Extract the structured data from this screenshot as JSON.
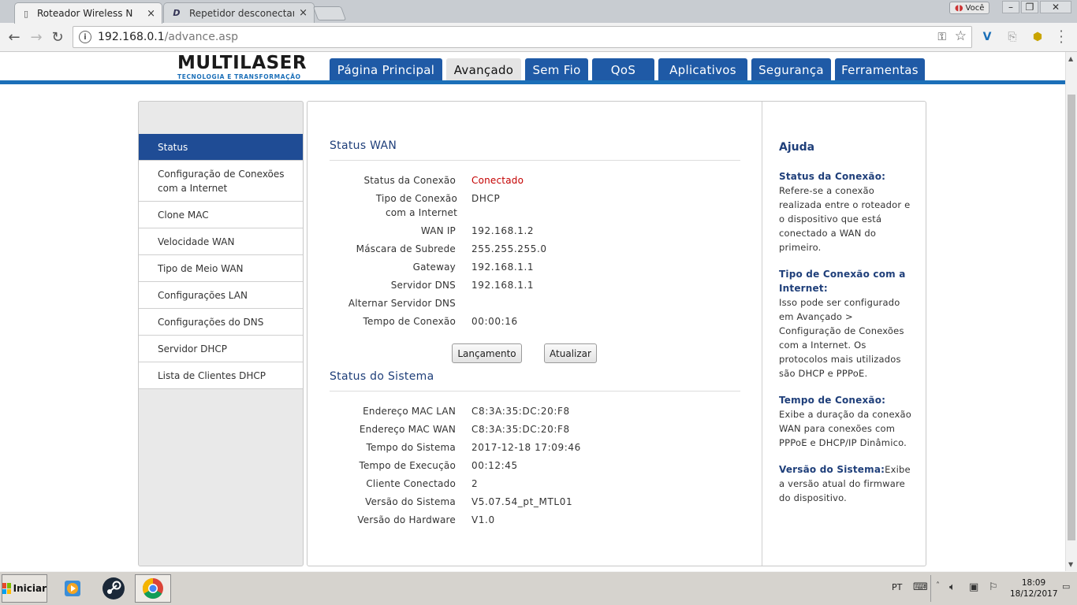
{
  "browser": {
    "tabs": [
      {
        "title": "Roteador Wireless N",
        "close": "×"
      },
      {
        "title": "Repetidor desconectando a",
        "close": "×"
      }
    ],
    "profile": "Você",
    "url_host": "192.168.0.1",
    "url_path": "/advance.asp"
  },
  "header": {
    "logo_main": "MULTILASER",
    "logo_sub": "TECNOLOGIA E TRANSFORMAÇÃO",
    "nav": [
      "Página Principal",
      "Avançado",
      "Sem Fio",
      "QoS",
      "Aplicativos",
      "Segurança",
      "Ferramentas"
    ],
    "active_nav": "Avançado"
  },
  "sidebar": {
    "items": [
      "Status",
      "Configuração de Conexões com a Internet",
      "Clone MAC",
      "Velocidade WAN",
      "Tipo de Meio WAN",
      "Configurações LAN",
      "Configurações do DNS",
      "Servidor DHCP",
      "Lista de Clientes DHCP"
    ],
    "active": "Status"
  },
  "wan": {
    "title": "Status WAN",
    "rows": [
      {
        "label": "Status da Conexão",
        "value": "Conectado"
      },
      {
        "label": "Tipo de Conexão com a Internet",
        "value": "DHCP"
      },
      {
        "label": "WAN IP",
        "value": "192.168.1.2"
      },
      {
        "label": "Máscara de Subrede",
        "value": "255.255.255.0"
      },
      {
        "label": "Gateway",
        "value": "192.168.1.1"
      },
      {
        "label": "Servidor DNS",
        "value": "192.168.1.1"
      },
      {
        "label": "Alternar Servidor DNS",
        "value": ""
      },
      {
        "label": "Tempo de Conexão",
        "value": "00:00:16"
      }
    ],
    "buttons": {
      "release": "Lançamento",
      "refresh": "Atualizar"
    },
    "status_color": "#c40000"
  },
  "system": {
    "title": "Status do Sistema",
    "rows": [
      {
        "label": "Endereço MAC LAN",
        "value": "C8:3A:35:DC:20:F8"
      },
      {
        "label": "Endereço MAC WAN",
        "value": "C8:3A:35:DC:20:F8"
      },
      {
        "label": "Tempo do Sistema",
        "value": "2017-12-18 17:09:46"
      },
      {
        "label": "Tempo de Execução",
        "value": "00:12:45"
      },
      {
        "label": "Cliente Conectado",
        "value": "2"
      },
      {
        "label": "Versão do Sistema",
        "value": "V5.07.54_pt_MTL01"
      },
      {
        "label": "Versão do Hardware",
        "value": "V1.0"
      }
    ]
  },
  "help": {
    "title": "Ajuda",
    "sections": [
      {
        "heading": "Status da Conexão:",
        "text": "Refere-se a conexão realizada entre o roteador e o dispositivo que está conectado a WAN do primeiro."
      },
      {
        "heading": "Tipo de Conexão com a Internet:",
        "text": "Isso pode ser configurado em Avançado > Configuração de Conexões com a Internet. Os protocolos mais utilizados são DHCP e PPPoE."
      },
      {
        "heading": "Tempo de Conexão:",
        "text": "Exibe a duração da conexão WAN para conexões com PPPoE e DHCP/IP Dinâmico."
      },
      {
        "heading": "Versão do Sistema:",
        "text": "Exibe a versão atual do firmware do dispositivo."
      }
    ]
  },
  "taskbar": {
    "start_label": "Iniciar",
    "language": "PT",
    "time": "18:09",
    "date": "18/12/2017"
  },
  "colors": {
    "nav_blue": "#1f5aa6",
    "sidebar_active": "#1f4c95",
    "heading_blue": "#1f3f7a",
    "stripe_blue": "#1b6fb8"
  }
}
